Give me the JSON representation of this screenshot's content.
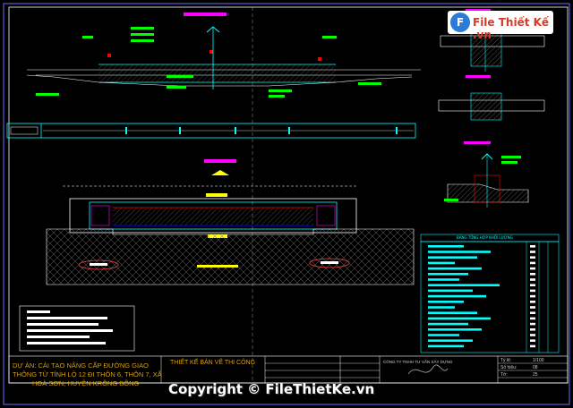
{
  "drawing": {
    "title_top_section": "CẮT DỌC CỐNG DẪN",
    "title_plan": "MẶT BẰNG CỐNG",
    "title_cross_top": "MẶT CẮT NGANG",
    "title_cross_mid": "MẶT CẮT ĐÁ LÁT",
    "title_cross_bottom": "MẶT CẮT HỐ GA",
    "table_title": "BẢNG TỔNG HỢP KHỐI LƯỢNG",
    "scale": "1/100"
  },
  "title_block": {
    "project_label": "DỰ ÁN: CẢI TẠO NÂNG CẤP ĐƯỜNG GIAO THÔNG TỪ TỈNH LỘ 12 ĐI THÔN 6, THÔN 7, XÃ HOÀ SƠN, HUYỆN KRÔNG BÔNG",
    "project_line1": "DỰ ÁN: CẢI TẠO NÂNG CẤP ĐƯỜNG GIAO",
    "project_line2": "THÔNG TỪ TỈNH LỘ 12 ĐI THÔN 6, THÔN 7, XÃ",
    "project_line3": "HOÀ SƠN, HUYỆN KRÔNG BÔNG",
    "design_stage": "THIẾT KẾ BẢN VẼ THI CÔNG",
    "company": "CÔNG TY TNHH TƯ VẤN XÂY DỰNG",
    "scale_label": "Tỷ lệ:",
    "scale_value": "1/100",
    "sheet_label": "Số hiệu:",
    "sheet_value": "08",
    "page_label": "Tờ:",
    "page_value": "25"
  },
  "watermark": {
    "logo_mark": "F",
    "logo_text": "File Thiết Kế .vn",
    "copyright": "Copyright © FileThietKe.vn"
  },
  "colors": {
    "background": "#000000",
    "frame": "#ffffff",
    "primary_line": "#ffffff",
    "accent_cyan": "#00ffff",
    "accent_green": "#00ff00",
    "accent_magenta": "#ff00ff",
    "accent_yellow": "#ffff00",
    "accent_red": "#ff0000",
    "hatch": "#8a8a8a",
    "table_line": "#00ffff"
  }
}
